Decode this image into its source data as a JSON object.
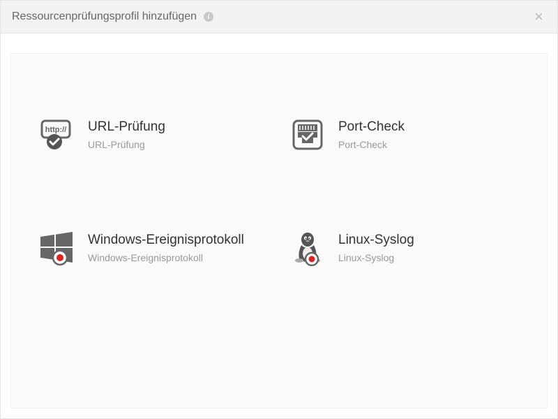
{
  "header": {
    "title": "Ressourcenprüfungsprofil hinzufügen"
  },
  "tiles": [
    {
      "title": "URL-Prüfung",
      "subtitle": "URL-Prüfung"
    },
    {
      "title": "Port-Check",
      "subtitle": "Port-Check"
    },
    {
      "title": "Windows-Ereignisprotokoll",
      "subtitle": "Windows-Ereignisprotokoll"
    },
    {
      "title": "Linux-Syslog",
      "subtitle": "Linux-Syslog"
    }
  ]
}
